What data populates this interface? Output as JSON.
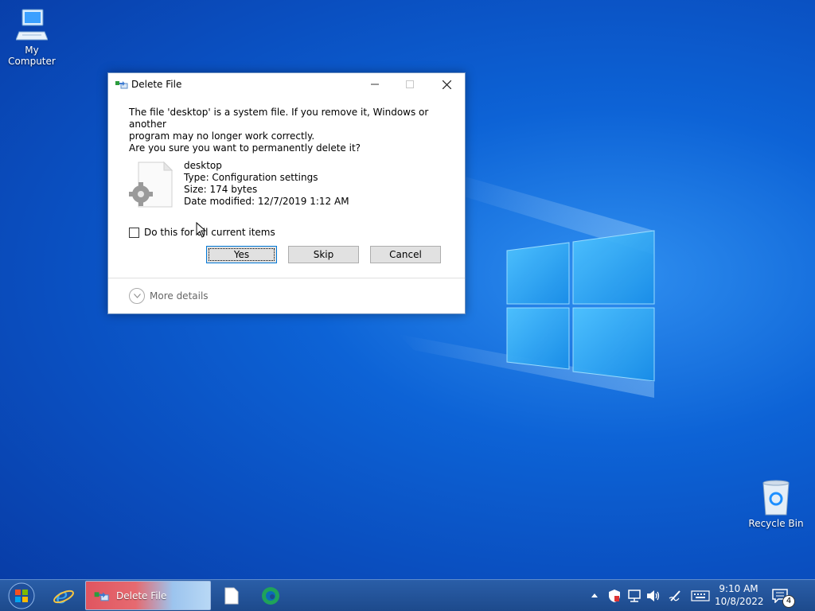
{
  "desktop": {
    "icons": [
      {
        "label": "My Computer"
      },
      {
        "label": "Recycle Bin"
      }
    ]
  },
  "dialog": {
    "title": "Delete File",
    "message_line1": "The file 'desktop' is a system file. If you remove it, Windows or another",
    "message_line2": "program may no longer work correctly.",
    "question": "Are you sure you want to permanently delete it?",
    "file": {
      "name": "desktop",
      "type": "Type: Configuration settings",
      "size": "Size: 174 bytes",
      "date": "Date modified: 12/7/2019 1:12 AM"
    },
    "checkbox_label": "Do this for all current items",
    "checkbox_checked": false,
    "buttons": {
      "yes": "Yes",
      "skip": "Skip",
      "cancel": "Cancel"
    },
    "more_details": "More details"
  },
  "taskbar": {
    "active_task": "Delete File",
    "time": "9:10 AM",
    "date": "10/8/2022",
    "notification_count": "4"
  },
  "colors": {
    "accent": "#0078d7",
    "taskbar": "#1d4a8c",
    "desktop_bg": "#0a4fc0"
  }
}
